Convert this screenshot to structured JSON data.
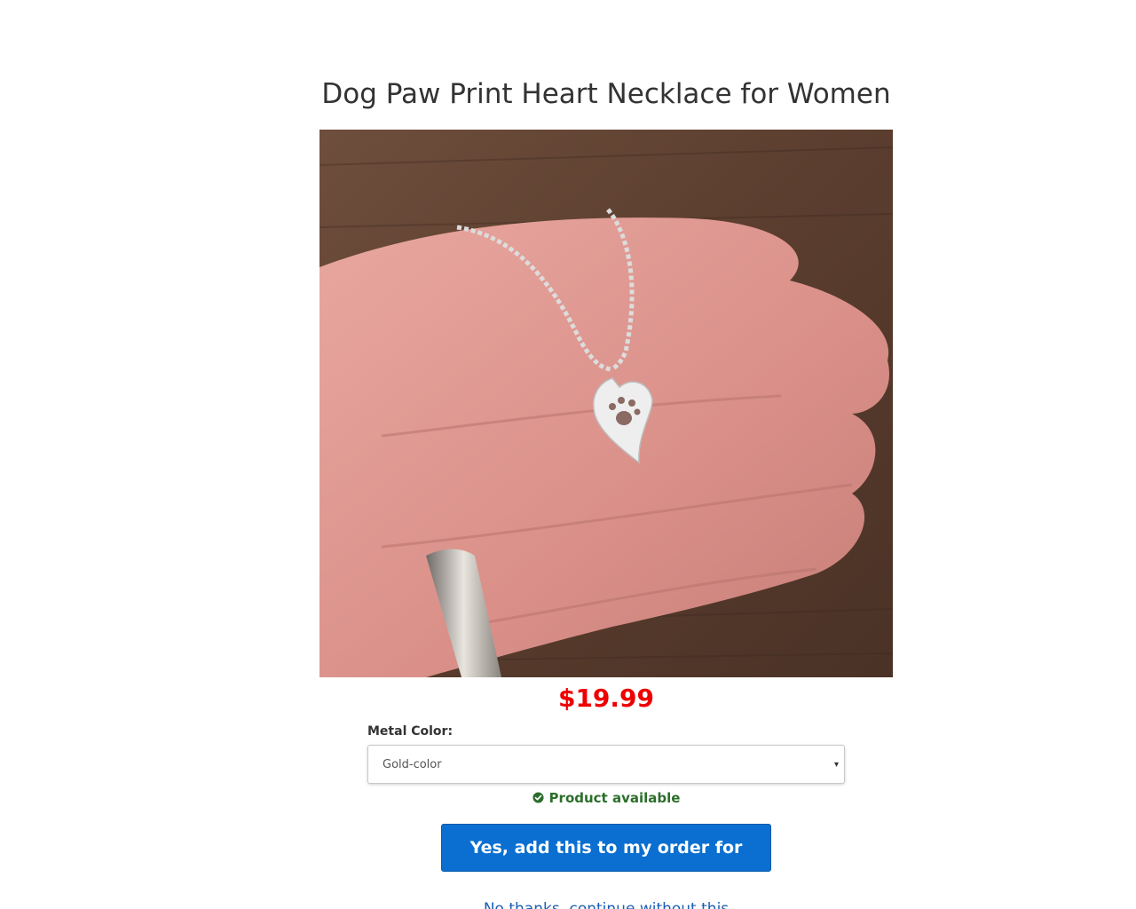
{
  "product": {
    "title": "Dog Paw Print Heart Necklace for Women",
    "image_alt": "Silver heart pendant with paw print cutout on chain held in palm",
    "price": "$19.99"
  },
  "options": {
    "label": "Metal Color:",
    "selected": "Gold-color"
  },
  "status": {
    "availability": "Product available",
    "color": "#2b6e2b"
  },
  "actions": {
    "add_label": "Yes, add this to my order for $19.99",
    "decline_label": "No thanks, continue without this"
  },
  "colors": {
    "price": "#ee0000",
    "button": "#0a6fd0",
    "link": "#1a5fb4"
  }
}
